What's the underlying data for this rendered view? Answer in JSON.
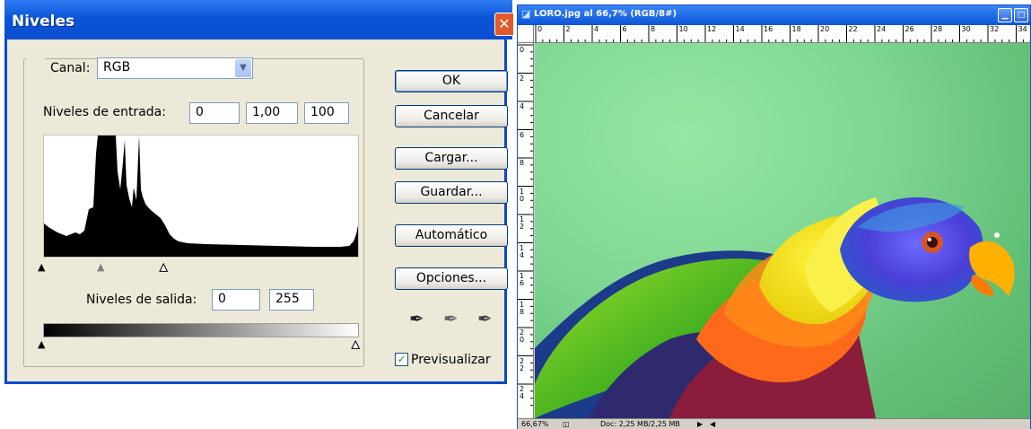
{
  "dialog": {
    "title": "Niveles",
    "close_glyph": "✕",
    "channel": {
      "label": "Canal:",
      "value": "RGB"
    },
    "input_levels": {
      "label": "Niveles de entrada:",
      "black": "0",
      "gamma": "1,00",
      "white": "100"
    },
    "output_levels": {
      "label": "Niveles de salida:",
      "black": "0",
      "white": "255"
    },
    "buttons": {
      "ok": "OK",
      "cancel": "Cancelar",
      "load": "Cargar...",
      "save": "Guardar...",
      "auto": "Automático",
      "options": "Opciones..."
    },
    "preview": {
      "label": "Previsualizar",
      "checked": true
    },
    "eyedropper_icons": [
      "black-eyedropper-icon",
      "gray-eyedropper-icon",
      "white-eyedropper-icon"
    ]
  },
  "image_window": {
    "title": "LORO.jpg al 66,7% (RGB/8#)",
    "ruler_top": [
      "0",
      "2",
      "4",
      "6",
      "8",
      "10",
      "12",
      "14",
      "16",
      "18",
      "20",
      "22",
      "24",
      "26",
      "28",
      "30",
      "32",
      "34"
    ],
    "ruler_left": [
      "0",
      "2",
      "4",
      "6",
      "8",
      "1\n0",
      "1\n2",
      "1\n4",
      "1\n6",
      "1\n8",
      "2\n0",
      "2\n2",
      "2\n4"
    ],
    "status": {
      "zoom": "66,67%",
      "doc": "Doc: 2,25 MB/2,25 MB"
    }
  },
  "colors": {
    "titlebar_blue": "#0a55d8",
    "dialog_face": "#ece9d8",
    "close_red": "#e25a2c",
    "background_green": "#7fd793",
    "parrot_head_blue": "#4a3fd8",
    "parrot_breast_yellow": "#f4e81a",
    "parrot_orange": "#ff6a1a",
    "beak_orange": "#ffb000"
  }
}
